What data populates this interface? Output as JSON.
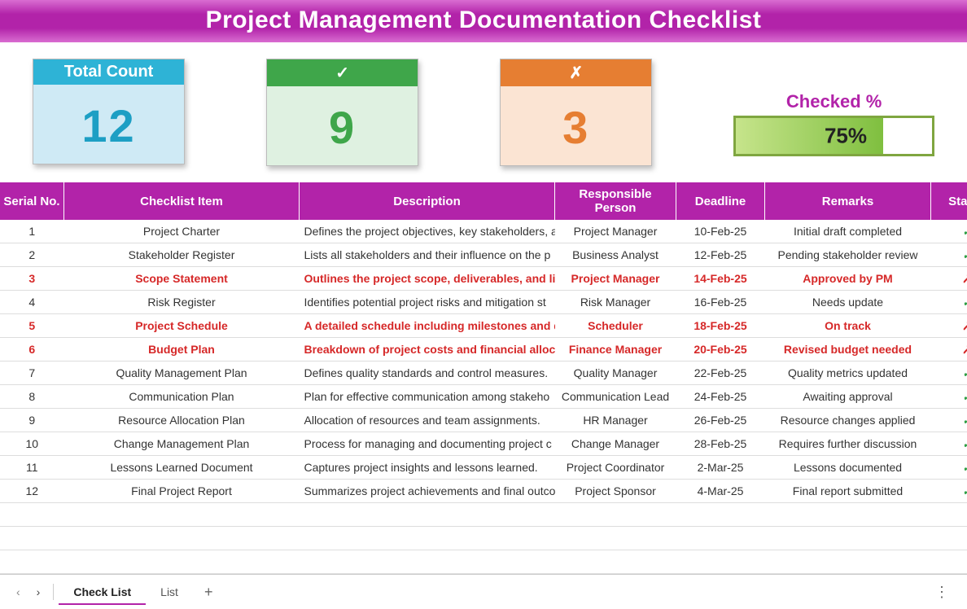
{
  "title": "Project Management Documentation Checklist",
  "cards": {
    "total": {
      "label": "Total Count",
      "value": "12"
    },
    "checked": {
      "label": "✓",
      "value": "9"
    },
    "unchecked": {
      "label": "✗",
      "value": "3"
    }
  },
  "progress": {
    "label": "Checked %",
    "value": "75%",
    "percent": 75
  },
  "columns": {
    "sn": "Serial No.",
    "item": "Checklist Item",
    "desc": "Description",
    "resp": "Responsible Person",
    "dead": "Deadline",
    "rem": "Remarks",
    "stat": "Status"
  },
  "rows": [
    {
      "sn": "1",
      "item": "Project Charter",
      "desc": "Defines the project objectives, key stakeholders, a",
      "resp": "Project Manager",
      "dead": "10-Feb-25",
      "rem": "Initial draft completed",
      "stat": "✓",
      "red": false
    },
    {
      "sn": "2",
      "item": "Stakeholder Register",
      "desc": "Lists all stakeholders and their influence on the p",
      "resp": "Business Analyst",
      "dead": "12-Feb-25",
      "rem": "Pending stakeholder review",
      "stat": "✓",
      "red": false
    },
    {
      "sn": "3",
      "item": "Scope Statement",
      "desc": "Outlines the project scope, deliverables, and lim",
      "resp": "Project Manager",
      "dead": "14-Feb-25",
      "rem": "Approved by PM",
      "stat": "✗",
      "red": true
    },
    {
      "sn": "4",
      "item": "Risk Register",
      "desc": "Identifies potential project risks and mitigation st",
      "resp": "Risk Manager",
      "dead": "16-Feb-25",
      "rem": "Needs update",
      "stat": "✓",
      "red": false
    },
    {
      "sn": "5",
      "item": "Project Schedule",
      "desc": "A detailed schedule including milestones and de",
      "resp": "Scheduler",
      "dead": "18-Feb-25",
      "rem": "On track",
      "stat": "✗",
      "red": true
    },
    {
      "sn": "6",
      "item": "Budget Plan",
      "desc": "Breakdown of project costs and financial allocati",
      "resp": "Finance Manager",
      "dead": "20-Feb-25",
      "rem": "Revised budget needed",
      "stat": "✗",
      "red": true
    },
    {
      "sn": "7",
      "item": "Quality Management Plan",
      "desc": "Defines quality standards and control measures.",
      "resp": "Quality Manager",
      "dead": "22-Feb-25",
      "rem": "Quality metrics updated",
      "stat": "✓",
      "red": false
    },
    {
      "sn": "8",
      "item": "Communication Plan",
      "desc": "Plan for effective communication among stakeho",
      "resp": "Communication Lead",
      "dead": "24-Feb-25",
      "rem": "Awaiting approval",
      "stat": "✓",
      "red": false
    },
    {
      "sn": "9",
      "item": "Resource Allocation Plan",
      "desc": "Allocation of resources and team assignments.",
      "resp": "HR Manager",
      "dead": "26-Feb-25",
      "rem": "Resource changes applied",
      "stat": "✓",
      "red": false
    },
    {
      "sn": "10",
      "item": "Change Management Plan",
      "desc": "Process for managing and documenting project c",
      "resp": "Change Manager",
      "dead": "28-Feb-25",
      "rem": "Requires further discussion",
      "stat": "✓",
      "red": false
    },
    {
      "sn": "11",
      "item": "Lessons Learned Document",
      "desc": "Captures project insights and lessons learned.",
      "resp": "Project Coordinator",
      "dead": "2-Mar-25",
      "rem": "Lessons documented",
      "stat": "✓",
      "red": false
    },
    {
      "sn": "12",
      "item": "Final Project Report",
      "desc": "Summarizes project achievements and final outco",
      "resp": "Project Sponsor",
      "dead": "4-Mar-25",
      "rem": "Final report submitted",
      "stat": "✓",
      "red": false
    }
  ],
  "tabs": {
    "active": "Check List",
    "other": "List"
  },
  "chart_data": {
    "type": "bar",
    "title": "Checked %",
    "categories": [
      "Checked"
    ],
    "values": [
      75
    ],
    "ylim": [
      0,
      100
    ],
    "xlabel": "",
    "ylabel": "%"
  }
}
